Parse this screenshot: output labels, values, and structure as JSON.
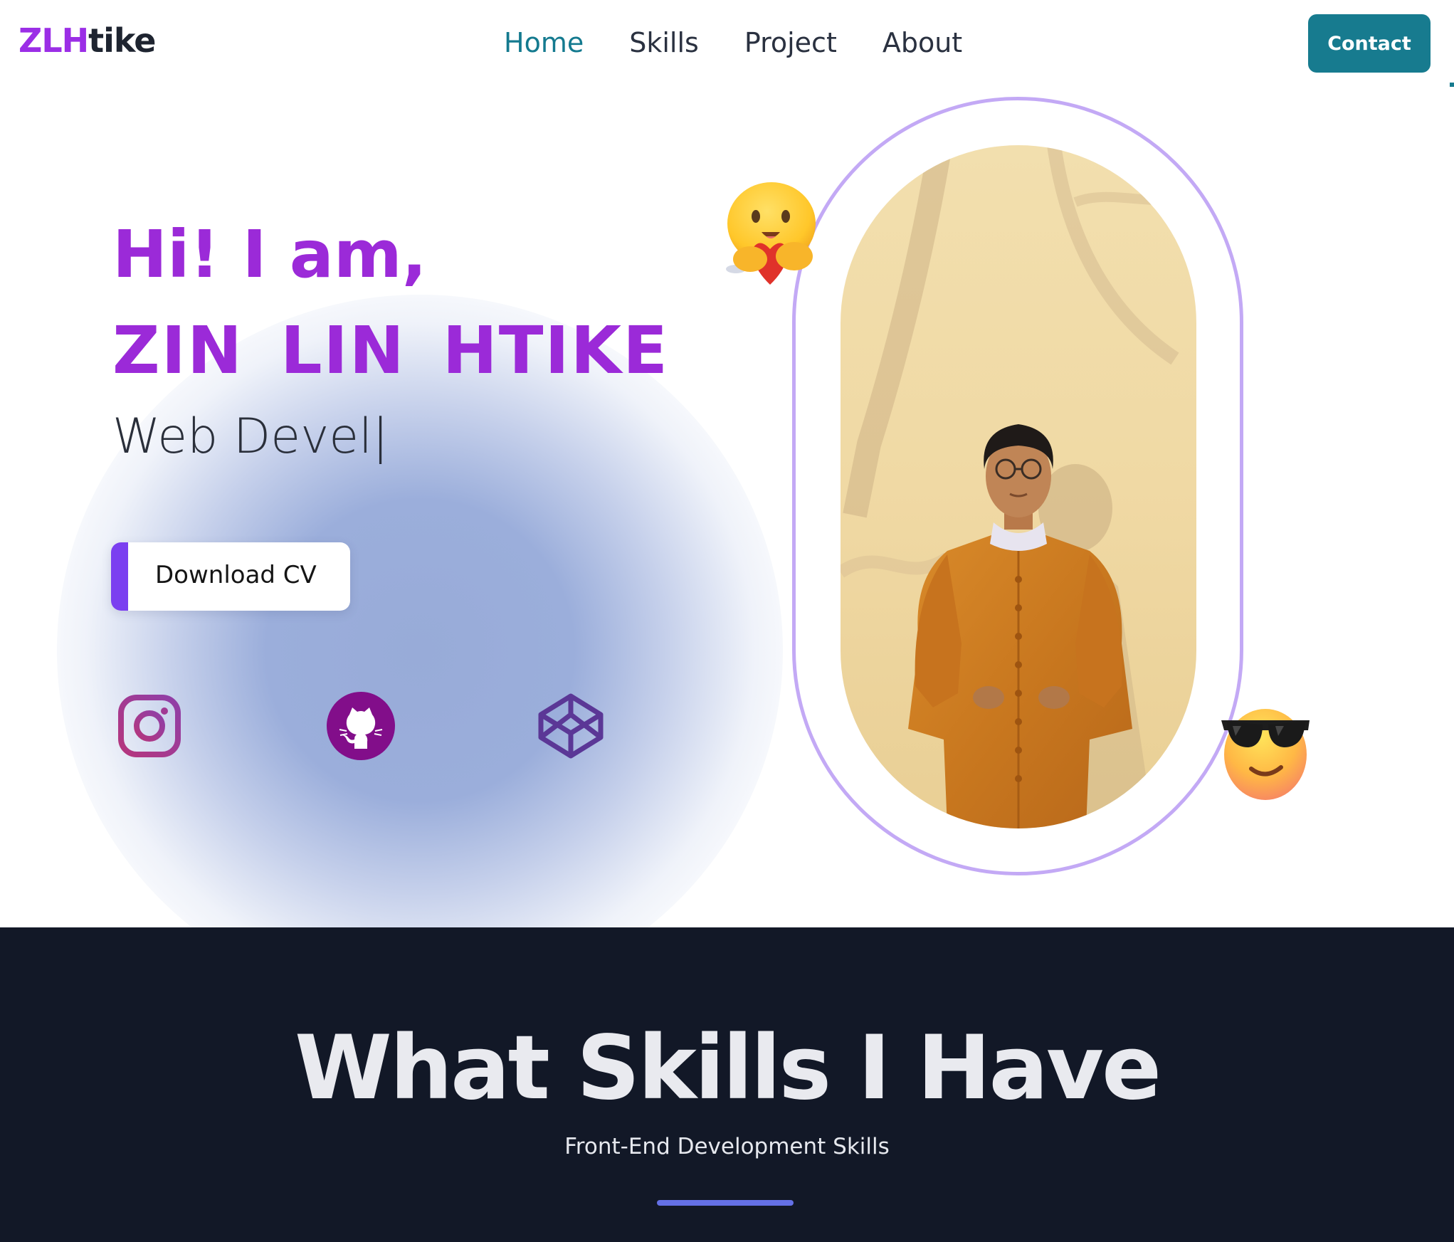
{
  "nav": {
    "logo_part1": "ZLH",
    "logo_part2": "tike",
    "links": [
      "Home",
      "Skills",
      "Project",
      "About"
    ],
    "active_link": "Home",
    "contact_label": "Contact"
  },
  "hero": {
    "greeting": "Hi! I am,",
    "name_parts": [
      "ZIN",
      "LIN",
      "HTIKE"
    ],
    "typed_text": "Web Devel",
    "cursor": "|",
    "cv_button_label": "Download CV",
    "socials": [
      {
        "icon": "instagram-icon"
      },
      {
        "icon": "github-icon"
      },
      {
        "icon": "codepen-icon"
      }
    ],
    "emojis": [
      "hugging-face-heart",
      "sunglasses-face"
    ]
  },
  "skills": {
    "title": "What Skills I Have",
    "subtitle": "Front-End Development Skills"
  },
  "colors": {
    "accent_purple": "#9b2ad8",
    "nav_active": "#147a8f",
    "contact_button": "#177b8f",
    "ring": "#c3a9f5",
    "skills_bg": "#121827",
    "underline": "#6470e6"
  }
}
